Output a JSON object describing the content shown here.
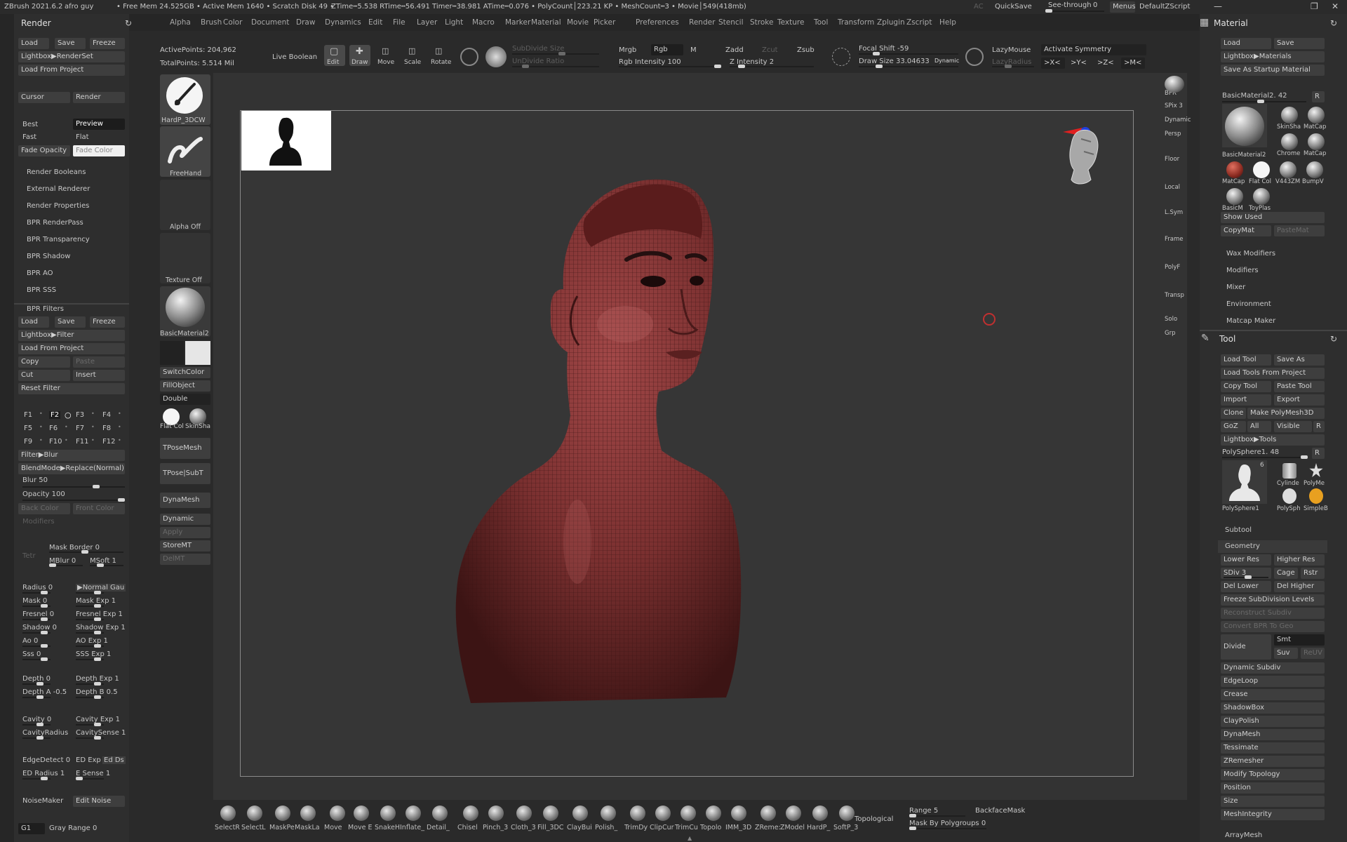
{
  "titlebar": {
    "app": "ZBrush 2021.6.2",
    "user": "afro guy",
    "dot": "•",
    "freemem": "• Free Mem 24.525GB • Active Mem 1640 • Scratch Disk 49 •",
    "stats": "ZTime┅5.538 RTime┅56.491 Timer┅38.981 ATime┅0.076 • PolyCount│223.21 KP • MeshCount┅3 • Movie│549(418mb)",
    "ac": "AC",
    "quicksave": "QuickSave",
    "seethrough": "See-through",
    "seethrough_val": "0",
    "menus": "Menus",
    "script": "DefaultZScript"
  },
  "menus": [
    "Alpha",
    "Brush",
    "Color",
    "Document",
    "Draw",
    "Dynamics",
    "Edit",
    "File",
    "Layer",
    "Light",
    "Macro",
    "Marker",
    "Material",
    "Movie",
    "Picker",
    "Preferences",
    "Render",
    "Stencil",
    "Stroke",
    "Texture",
    "Tool",
    "Transform",
    "Zplugin",
    "Zscript",
    "Help"
  ],
  "render": {
    "title": "Render",
    "load": "Load",
    "save": "Save",
    "freeze": "Freeze",
    "lightbox": "Lightbox▶RenderSet",
    "load_project": "Load From Project",
    "cursor": "Cursor",
    "render_btn": "Render",
    "best": "Best",
    "preview": "Preview",
    "fast": "Fast",
    "flat": "Flat",
    "fade_opacity": "Fade Opacity",
    "fade_color": "Fade Color",
    "subsections": [
      "Render Booleans",
      "External Renderer",
      "Render Properties",
      "BPR RenderPass",
      "BPR Transparency",
      "BPR Shadow",
      "BPR AO",
      "BPR SSS"
    ],
    "filters_title": "BPR Filters",
    "f_load": "Load",
    "f_save": "Save",
    "f_freeze": "Freeze",
    "f_lightbox": "Lightbox▶Filter",
    "f_load_project": "Load From Project",
    "copy": "Copy",
    "paste": "Paste",
    "cut": "Cut",
    "insert": "Insert",
    "reset": "Reset Filter",
    "fslots": [
      "F1",
      "F2",
      "F3",
      "F4",
      "F5",
      "F6",
      "F7",
      "F8",
      "F9",
      "F10",
      "F11",
      "F12"
    ],
    "filter_blur": "Filter▶Blur",
    "blendmode": "BlendMode▶Replace(Normal)",
    "blur": "Blur 50",
    "opacity": "Opacity 100",
    "back_color": "Back Color",
    "front_color": "Front Color",
    "modifiers": "Modifiers",
    "tetr": "Tetr",
    "mask_border": "Mask Border 0",
    "mblur": "MBlur 0",
    "msoft": "MSoft 1",
    "params": [
      [
        "Radius 0",
        "▶Normal Gau"
      ],
      [
        "Mask 0",
        "Mask Exp 1"
      ],
      [
        "Fresnel 0",
        "Fresnel Exp 1"
      ],
      [
        "Shadow 0",
        "Shadow Exp 1"
      ],
      [
        "Ao 0",
        "AO Exp 1"
      ],
      [
        "Sss 0",
        "SSS Exp 1"
      ]
    ],
    "depth": [
      "Depth 0",
      "Depth Exp 1"
    ],
    "depth_a": [
      "Depth A -0.5",
      "Depth B 0.5"
    ],
    "cavity": [
      "Cavity 0",
      "Cavity Exp 1"
    ],
    "cavity_radius": [
      "CavityRadius",
      "CavitySense 1"
    ],
    "edgedetect": [
      "EdgeDetect 0",
      "ED Exp",
      "Ed Ds"
    ],
    "ed_radius": [
      "ED Radius 1",
      "E Sense 1"
    ],
    "noisemaker": "NoiseMaker",
    "edit_noise": "Edit Noise",
    "g1": "G1",
    "gray_range": "Gray Range 0"
  },
  "topshelf": {
    "active_points": "ActivePoints: 204,962",
    "total_points": "TotalPoints: 5.514 Mil",
    "live_boolean": "Live Boolean",
    "edit": "Edit",
    "draw": "Draw",
    "move": "Move",
    "scale": "Scale",
    "rotate": "Rotate",
    "subdivide": "SubDivide Size",
    "undivide": "UnDivide Ratio",
    "mrgb": "Mrgb",
    "rgb": "Rgb",
    "m": "M",
    "rgb_intensity": "Rgb Intensity 100",
    "zadd": "Zadd",
    "zcut": "Zcut",
    "zsub": "Zsub",
    "z_intensity": "Z Intensity 2",
    "focal_shift": "Focal Shift -59",
    "draw_size": "Draw Size 33.04633",
    "dynamic": "Dynamic",
    "lazymouse": "LazyMouse",
    "lazyradius": "LazyRadius",
    "activate_symmetry": "Activate Symmetry",
    "sym_x": ">X<",
    "sym_y": ">Y<",
    "sym_z": ">Z<",
    "sym_m": ">M<"
  },
  "toolshelf": {
    "brush": "HardP_3DCW",
    "stroke": "FreeHand",
    "alpha": "Alpha Off",
    "texture": "Texture Off",
    "material": "BasicMaterial2",
    "switchcolor": "SwitchColor",
    "fillobject": "FillObject",
    "double": "Double",
    "flatcol": "Flat Col",
    "skinsha": "SkinSha",
    "tposemesh": "TPoseMesh",
    "tposesubt": "TPose|SubT",
    "dynamesh": "DynaMesh",
    "dynamic": "Dynamic",
    "apply": "Apply",
    "storemt": "StoreMT",
    "delmt": "DelMT"
  },
  "rightstrip": [
    "BPR",
    "SPix 3",
    "Dynamic",
    "Persp",
    "Floor",
    "Local",
    "L.Sym",
    "Frame",
    "PolyF",
    "Transp",
    "Solo",
    "Grp"
  ],
  "material": {
    "title": "Material",
    "load": "Load",
    "save": "Save",
    "lightbox": "Lightbox▶Materials",
    "save_startup": "Save As Startup Material",
    "current": "BasicMaterial2. 42",
    "r": "R",
    "thumbs": [
      "SkinSha",
      "MatCap",
      "Chrome",
      "MatCap",
      "BasicMaterial2",
      "MatCap",
      "Flat Col",
      "V443ZM",
      "BumpV",
      "BasicM",
      "ToyPlas"
    ],
    "show_used": "Show Used",
    "copymat": "CopyMat",
    "pastemat": "PasteMat",
    "subsections": [
      "Wax Modifiers",
      "Modifiers",
      "Mixer",
      "Environment",
      "Matcap Maker"
    ]
  },
  "tool": {
    "title": "Tool",
    "load_tool": "Load Tool",
    "save_as": "Save As",
    "load_project": "Load Tools From Project",
    "copy_tool": "Copy Tool",
    "paste_tool": "Paste Tool",
    "import": "Import",
    "export": "Export",
    "clone": "Clone",
    "make_polymesh": "Make PolyMesh3D",
    "goz": "GoZ",
    "all": "All",
    "visible": "Visible",
    "r": "R",
    "lightbox": "Lightbox▶Tools",
    "current": "PolySphere1. 48",
    "thumbs": [
      "PolySphere1",
      "Cylinde",
      "PolyMe",
      "PolySph",
      "SimpleB"
    ],
    "thumb_count": "6",
    "subtool": "Subtool",
    "geometry": "Geometry",
    "lower_res": "Lower Res",
    "higher_res": "Higher Res",
    "sdiv": "SDiv 3",
    "cage": "Cage",
    "rstr": "Rstr",
    "del_lower": "Del Lower",
    "del_higher": "Del Higher",
    "freeze_sub": "Freeze SubDivision Levels",
    "reconstruct": "Reconstruct Subdiv",
    "convert_bpr": "Convert BPR To Geo",
    "divide": "Divide",
    "smt": "Smt",
    "suv": "Suv",
    "reuv": "ReUV",
    "items": [
      "Dynamic Subdiv",
      "EdgeLoop",
      "Crease",
      "ShadowBox",
      "ClayPolish",
      "DynaMesh",
      "Tessimate",
      "ZRemesher",
      "Modify Topology",
      "Position",
      "Size",
      "MeshIntegrity"
    ],
    "arraymesh": "ArrayMesh"
  },
  "bottom": {
    "brushes": [
      "SelectR",
      "SelectL",
      "MaskPe",
      "MaskLa",
      "Move",
      "Move E",
      "SnakeH",
      "Inflate_",
      "Detail_",
      "Chisel",
      "Pinch_3",
      "Cloth_3",
      "Fill_3DC",
      "ClayBui",
      "Polish_",
      "TrimDy",
      "ClipCur",
      "TrimCu",
      "Topolo",
      "IMM_3D",
      "ZReme:",
      "ZModel",
      "HardP_",
      "SoftP_3"
    ],
    "topological": "Topological",
    "range": "Range 5",
    "backfacemask": "BackfaceMask",
    "mask_polygroups": "Mask By Polygroups 0"
  },
  "colors": {
    "bg": "#2a2a2a",
    "panel": "#2e2e2e",
    "button": "#3e3e3e",
    "skin": "#7a3030",
    "accent_slider": "#d6d6d6"
  }
}
